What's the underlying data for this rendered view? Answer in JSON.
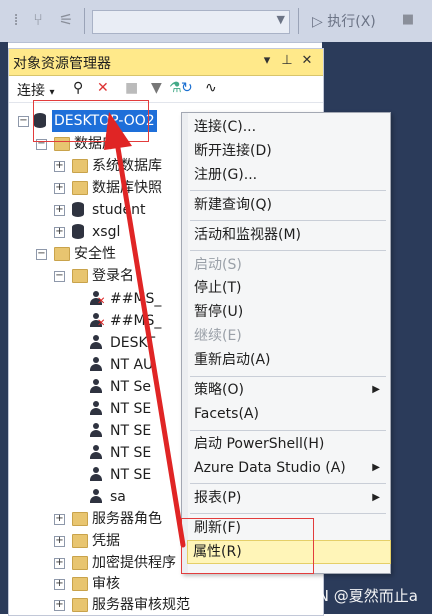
{
  "toolbar": {
    "execute_label": "执行(X)"
  },
  "panel": {
    "title": "对象资源管理器",
    "connect_label": "连接"
  },
  "tree": {
    "server": "DESKTOP-OO2",
    "databases": "数据库",
    "system_databases": "系统数据库",
    "db_snapshots": "数据库快照",
    "db_student": "student",
    "db_xsgl": "xsgl",
    "security": "安全性",
    "logins": "登录名",
    "login_1": "##MS_",
    "login_2": "##MS_",
    "login_3": "DESKT",
    "login_4": "NT AU",
    "login_5": "NT Se",
    "login_6": "NT SE",
    "login_7": "NT SE",
    "login_8": "NT SE",
    "login_9": "NT SE",
    "login_10": "sa",
    "server_roles": "服务器角色",
    "credentials": "凭据",
    "crypto_providers": "加密提供程序",
    "audit": "审核",
    "audit_specs": "服务器审核规范"
  },
  "menu": {
    "connect": "连接(C)...",
    "disconnect": "断开连接(D)",
    "register": "注册(G)...",
    "new_query": "新建查询(Q)",
    "activity_monitor": "活动和监视器(M)",
    "start": "启动(S)",
    "stop": "停止(T)",
    "pause": "暂停(U)",
    "resume": "继续(E)",
    "restart": "重新启动(A)",
    "policies": "策略(O)",
    "facets": "Facets(A)",
    "powershell": "启动 PowerShell(H)",
    "azure": "Azure Data Studio (A)",
    "reports": "报表(P)",
    "refresh": "刷新(F)",
    "properties": "属性(R)"
  },
  "watermark": "CSDN @夏然而止a",
  "colors": {
    "panel_header": "#ffe98a",
    "selection": "#1e6fd9",
    "highlight": "#fff5b8",
    "annotation_red": "#e23c3c"
  }
}
